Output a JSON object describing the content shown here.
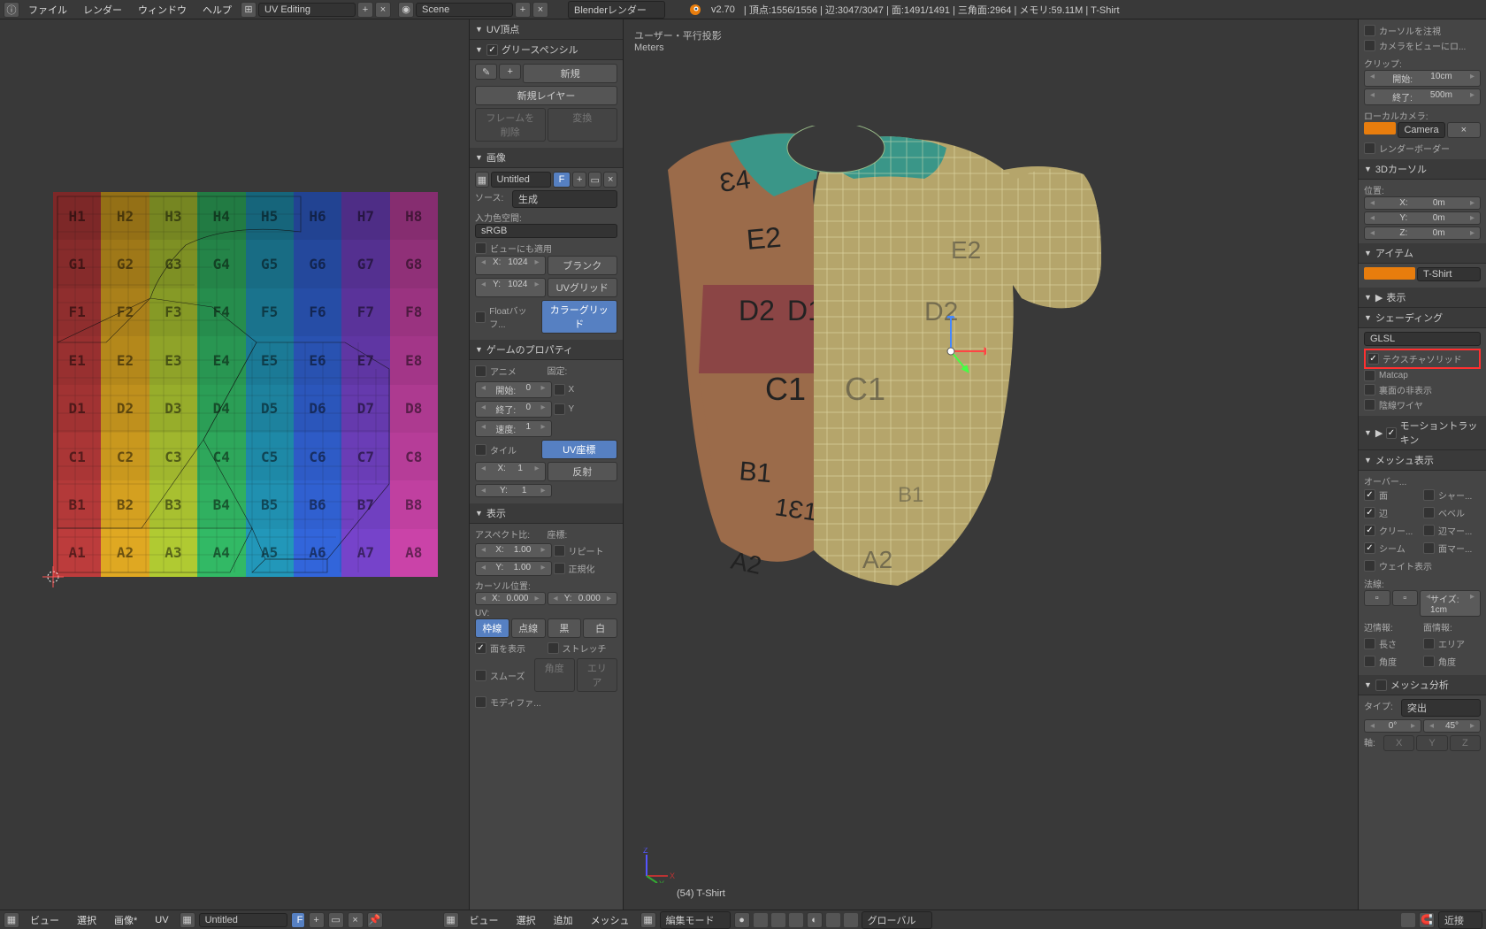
{
  "topbar": {
    "menus": [
      "ファイル",
      "レンダー",
      "ウィンドウ",
      "ヘルプ"
    ],
    "layout": "UV Editing",
    "scene": "Scene",
    "engine": "Blenderレンダー",
    "version": "v2.70",
    "stats": "頂点:1556/1556 | 辺:3047/3047 | 面:1491/1491 | 三角面:2964 | メモリ:59.11M | T-Shirt"
  },
  "mid": {
    "uv_vertex": "UV頂点",
    "grease": "グリースペンシル",
    "grease_new": "新規",
    "grease_layer": "新規レイヤー",
    "grease_delete": "フレームを削除",
    "grease_convert": "変換",
    "image": "画像",
    "image_name": "Untitled",
    "image_f": "F",
    "source": "ソース:",
    "source_val": "生成",
    "colorspace": "入力色空間:",
    "colorspace_val": "sRGB",
    "view_apply": "ビューにも適用",
    "x": "X:",
    "x_val": "1024",
    "y": "Y:",
    "y_val": "1024",
    "blank": "ブランク",
    "uvgrid": "UVグリッド",
    "colorgrid": "カラーグリッド",
    "floatbuf": "Floatバッフ...",
    "gameprops": "ゲームのプロパティ",
    "anime": "アニメ",
    "fixed": "固定:",
    "start": "開始:",
    "start_val": "0",
    "end": "終了:",
    "end_val": "0",
    "speed": "速度:",
    "speed_val": "1",
    "gx": "X",
    "gy": "Y",
    "tile": "タイル",
    "uvcoord": "UV座標",
    "reflect": "反射",
    "tx": "X:",
    "tx_val": "1",
    "ty": "Y:",
    "ty_val": "1",
    "display": "表示",
    "aspect": "アスペクト比:",
    "coords": "座標:",
    "ax": "X:",
    "ax_val": "1.00",
    "ay": "Y:",
    "ay_val": "1.00",
    "repeat": "リピート",
    "normalize": "正規化",
    "cursor": "カーソル位置:",
    "cx": "X:",
    "cx_val": "0.000",
    "cy": "Y:",
    "cy_val": "0.000",
    "uv_lbl": "UV:",
    "edge": "枠線",
    "dot": "点線",
    "black": "黒",
    "white": "白",
    "showface": "面を表示",
    "stretch": "ストレッチ",
    "smooth": "スムーズ",
    "angle": "角度",
    "area": "エリア",
    "modifier": "モディファ..."
  },
  "view3d": {
    "header": "ユーザー・平行投影",
    "units": "Meters",
    "obj": "(54) T-Shirt"
  },
  "right": {
    "cursor_center": "カーソルを注視",
    "camera_view": "カメラをビューにロ...",
    "clip": "クリップ:",
    "clip_start": "開始:",
    "clip_start_val": "10cm",
    "clip_end": "終了:",
    "clip_end_val": "500m",
    "local_cam": "ローカルカメラ:",
    "camera": "Camera",
    "render_border": "レンダーボーダー",
    "cursor3d": "3Dカーソル",
    "loc": "位置:",
    "lx": "X:",
    "lx_val": "0m",
    "ly": "Y:",
    "ly_val": "0m",
    "lz": "Z:",
    "lz_val": "0m",
    "item": "アイテム",
    "item_name": "T-Shirt",
    "display": "表示",
    "shading": "シェーディング",
    "glsl": "GLSL",
    "tex_solid": "テクスチャソリッド",
    "matcap": "Matcap",
    "backface": "裏面の非表示",
    "hidden_wire": "陰線ワイヤ",
    "motion_track": "モーショントラッキン",
    "mesh_display": "メッシュ表示",
    "overlay": "オーバー...",
    "face": "面",
    "sharp": "シャー...",
    "edge_chk": "辺",
    "bevel": "ベベル",
    "crease": "クリー...",
    "edge_mark": "辺マー...",
    "seam": "シーム",
    "face_mark": "面マー...",
    "weight": "ウェイト表示",
    "normals": "法線:",
    "size": "サイズ: 1cm",
    "edge_info": "辺情報:",
    "face_info": "面情報:",
    "length": "長さ",
    "area2": "エリア",
    "angle2": "角度",
    "angle3": "角度",
    "mesh_analysis": "メッシュ分析",
    "type": "タイプ:",
    "type_val": "突出",
    "a0": "0°",
    "a45": "45°",
    "axis": "軸:"
  },
  "status": {
    "view": "ビュー",
    "select": "選択",
    "image": "画像*",
    "uv": "UV",
    "img_name": "Untitled",
    "f": "F",
    "view2": "ビュー",
    "select2": "選択",
    "add": "追加",
    "mesh": "メッシュ",
    "mode": "編集モード",
    "orient": "グローバル",
    "snap": "近接"
  },
  "grid_letters": [
    "H",
    "G",
    "F",
    "E",
    "D",
    "C",
    "B",
    "A"
  ],
  "grid_colors": [
    "#b33939",
    "#d4a020",
    "#a8c030",
    "#30b060",
    "#2090b0",
    "#3060d0",
    "#7040c0",
    "#c040a0"
  ]
}
